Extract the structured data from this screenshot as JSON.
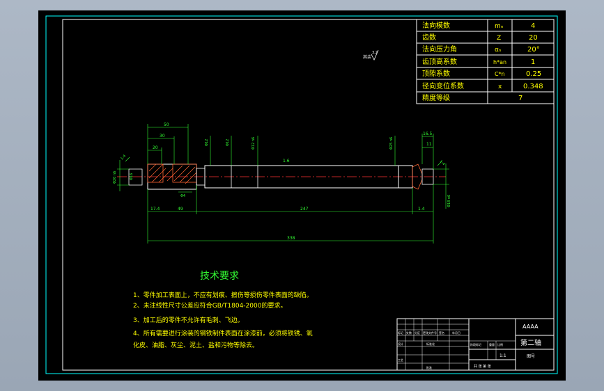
{
  "colors": {
    "frame": "#00ffff",
    "background": "#000000",
    "text_yellow": "#ffff00",
    "dim_green": "#33ff33",
    "outline_white": "#ffffff",
    "centerline_red": "#ff3333",
    "hatch_orange": "#ff6633"
  },
  "param_table": {
    "rows": [
      {
        "name": "法向模数",
        "symbol": "mₙ",
        "value": "4"
      },
      {
        "name": "齿数",
        "symbol": "Z",
        "value": "20"
      },
      {
        "name": "法向压力角",
        "symbol": "αₙ",
        "value": "20°"
      },
      {
        "name": "齿顶高系数",
        "symbol": "h*an",
        "value": "1"
      },
      {
        "name": "顶隙系数",
        "symbol": "C*n",
        "value": "0.25"
      },
      {
        "name": "径向变位系数",
        "symbol": "x",
        "value": "0.348"
      },
      {
        "name": "精度等级",
        "symbol": "",
        "value": "7"
      }
    ]
  },
  "roughness_note": "其余",
  "roughness_value": "3.2",
  "dimensions": {
    "top_50": "50",
    "top_30": "30",
    "top_20": "20",
    "dia_12a": "Φ12",
    "dia_12b": "Φ12",
    "dia_12_fit": "Φ12 n6",
    "dia_25_fit": "Φ25 n6",
    "right_16_5": "16.5",
    "right_11": "11",
    "left_14": "1:4",
    "left_dia": "Φ20 n6",
    "left_dia_b": "Φ16",
    "key_width": "Φ4",
    "bot_17_4": "17.4",
    "bot_49": "49",
    "bot_247": "247",
    "bot_1_4": "1.4",
    "total_338": "338",
    "right_dia": "Φ18 n6",
    "right_14": "1:4",
    "mid_rough": "1.6"
  },
  "tech_requirements": {
    "title": "技术要求",
    "items": [
      "1、零件加工表面上，不应有划痕、擦伤等损伤零件表面的缺陷。",
      "2、未注线性尺寸公差应符合GB/T1804-2000的要求。",
      "3、加工后的零件不允许有毛刺、飞边。",
      "4、所有需要进行涂装的钢铁制件表面在涂漆前，必须将铁锈、氧",
      "化皮、油脂、灰尘、泥土、盐和污物等除去。"
    ]
  },
  "title_block": {
    "company": "AAAA",
    "part_name": "第二轴",
    "drawing_no": "图号",
    "scale": "1:1",
    "labels": [
      "标记",
      "处数",
      "分区",
      "更改文件号",
      "签名",
      "年月日",
      "设计",
      "标准化",
      "阶段标记",
      "重量",
      "比例",
      "工艺",
      "批准",
      "共 张 第 张"
    ]
  }
}
